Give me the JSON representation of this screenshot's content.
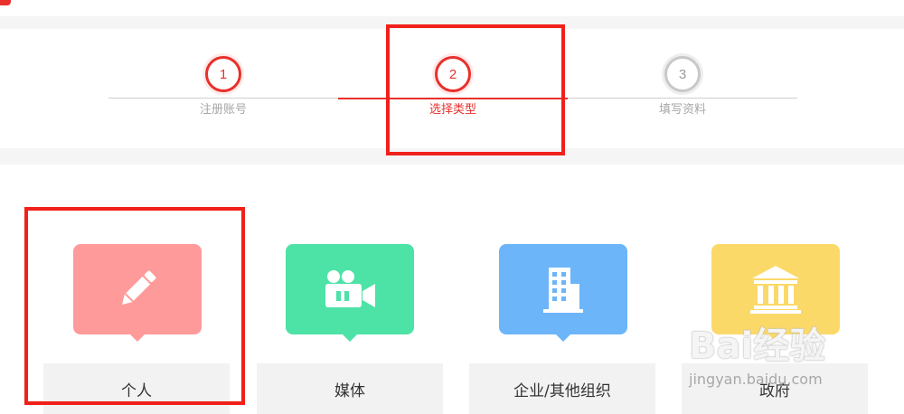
{
  "steps": [
    {
      "number": "1",
      "label": "注册账号"
    },
    {
      "number": "2",
      "label": "选择类型"
    },
    {
      "number": "3",
      "label": "填写资料"
    }
  ],
  "types": [
    {
      "label": "个人",
      "icon": "pencil-icon",
      "color": "#ff9a9a"
    },
    {
      "label": "媒体",
      "icon": "video-camera-icon",
      "color": "#4de2a6"
    },
    {
      "label": "企业/其他组织",
      "icon": "building-icon",
      "color": "#6cb5f9"
    },
    {
      "label": "政府",
      "icon": "government-building-icon",
      "color": "#fbd969"
    }
  ],
  "colors": {
    "accent": "#e8302c",
    "highlight": "#f0201b"
  },
  "watermark": {
    "logo_text": "Bai经验",
    "url_text": "jingyan.baidu.com"
  }
}
